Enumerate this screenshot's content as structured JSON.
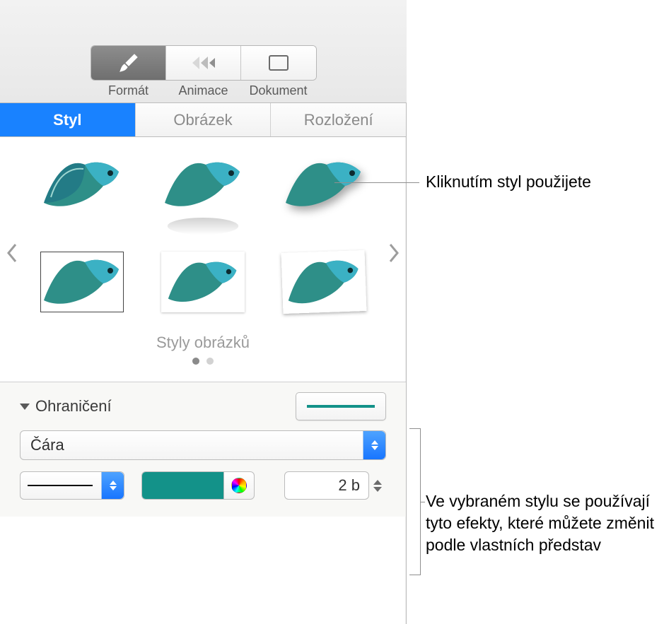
{
  "toolbar": {
    "format": "Formát",
    "animate": "Animace",
    "document": "Dokument"
  },
  "tabs": {
    "style": "Styl",
    "image": "Obrázek",
    "layout": "Rozložení"
  },
  "gallery": {
    "caption": "Styly obrázků"
  },
  "border": {
    "title": "Ohraničení",
    "line_type": "Čára",
    "width_value": "2 b",
    "color": "#139289"
  },
  "callouts": {
    "apply_style": "Kliknutím styl použijete",
    "effects_note": "Ve vybraném stylu se používají tyto efekty, které můžete změnit podle vlastních představ"
  }
}
